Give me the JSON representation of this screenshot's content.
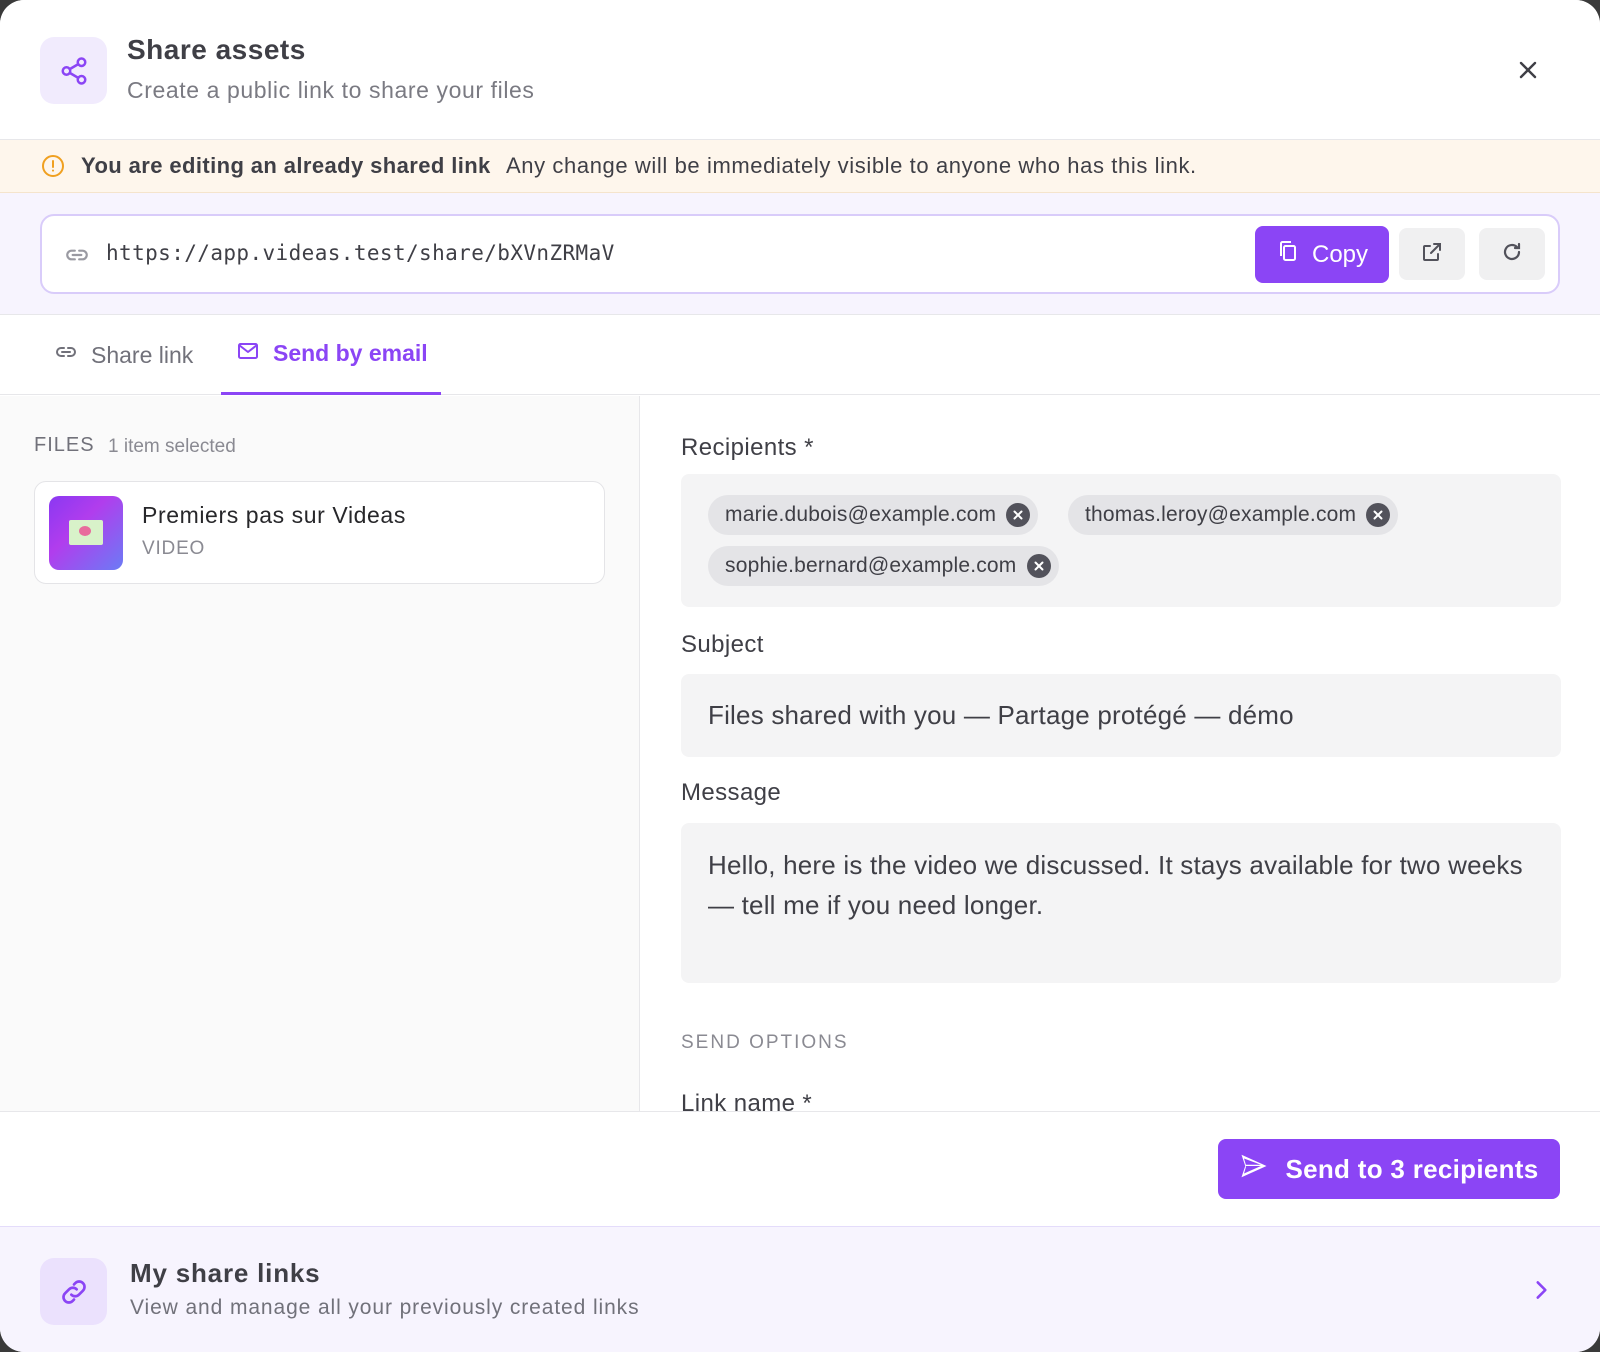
{
  "header": {
    "title": "Share assets",
    "subtitle": "Create a public link to share your files",
    "icon": "share-icon",
    "close_icon": "close-icon"
  },
  "banner": {
    "icon": "alert-circle-icon",
    "bold_text": "You are editing an already shared link",
    "text": "Any change will be immediately visible to anyone who has this link."
  },
  "share_link": {
    "url": "https://app.videas.test/share/bXVnZRMaV",
    "copy_label": "Copy"
  },
  "tabs": [
    {
      "label": "Share link",
      "icon": "link-icon",
      "active": false
    },
    {
      "label": "Send by email",
      "icon": "mail-icon",
      "active": true
    }
  ],
  "files": {
    "label": "FILES",
    "count_text": "1 item selected",
    "items": [
      {
        "name": "Premiers pas sur Videas",
        "type": "VIDEO"
      }
    ]
  },
  "form": {
    "recipients_label": "Recipients *",
    "recipients": [
      "marie.dubois@example.com",
      "thomas.leroy@example.com",
      "sophie.bernard@example.com"
    ],
    "subject_label": "Subject",
    "subject_value": "Files shared with you — Partage protégé — démo",
    "message_label": "Message",
    "message_value": "Hello, here is the video we discussed. It stays available for two weeks — tell me if you need longer.",
    "send_options_label": "SEND OPTIONS",
    "link_name_label": "Link name *"
  },
  "footer": {
    "send_label": "Send to 3 recipients"
  },
  "my_links": {
    "title": "My share links",
    "subtitle": "View and manage all your previously created links"
  },
  "colors": {
    "accent": "#8b45f5",
    "banner_bg": "#fef6ec",
    "warning": "#f0a020"
  }
}
